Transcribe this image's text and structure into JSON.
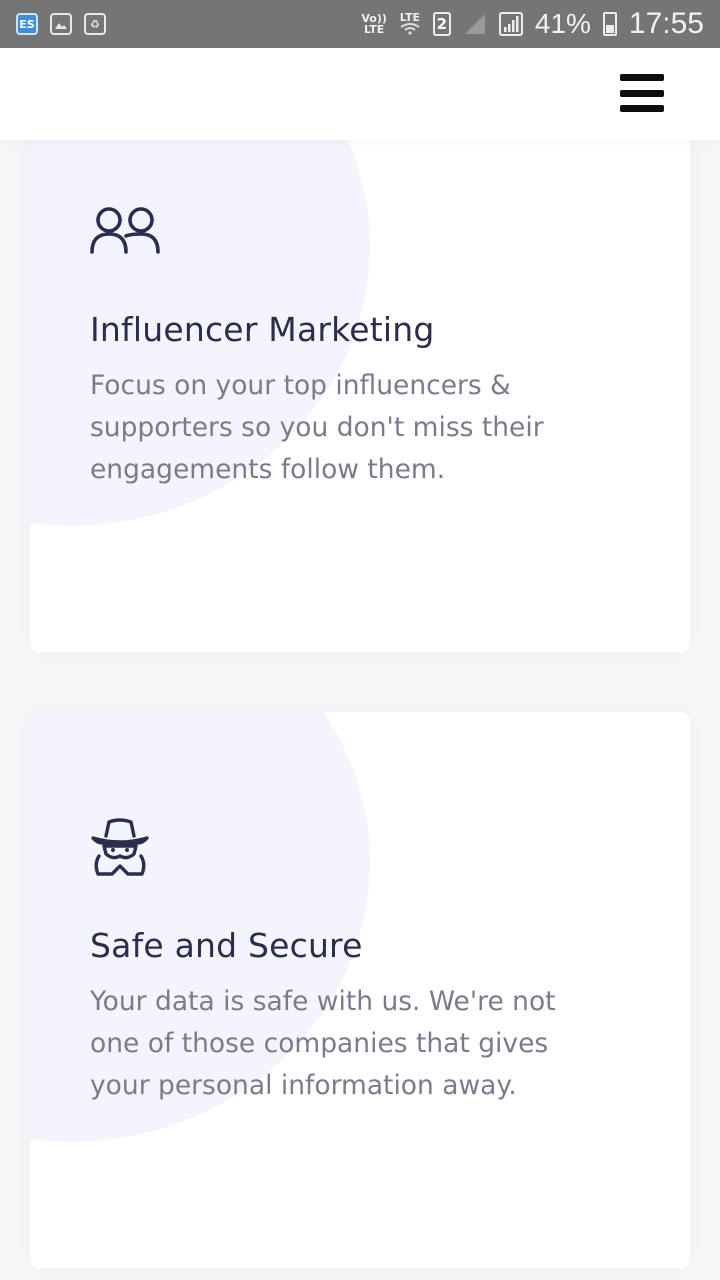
{
  "status_bar": {
    "volte_top": "Vo))",
    "volte_bottom": "LTE",
    "lte_label": "LTE",
    "sim_slot": "2",
    "battery_percent": "41%",
    "time": "17:55",
    "left_icons": [
      "es-file-explorer-icon",
      "gallery-icon",
      "recycle-icon"
    ]
  },
  "navbar": {
    "menu_icon": "hamburger-menu-icon"
  },
  "features": [
    {
      "icon": "users-icon",
      "title": "Influencer Marketing",
      "description": "Focus on your top influencers & supporters so you don't miss their engagements follow them."
    },
    {
      "icon": "spy-incognito-icon",
      "title": "Safe and Secure",
      "description": "Your data is safe with us. We're not one of those companies that gives your personal information away."
    }
  ],
  "colors": {
    "title": "#2c2c4e",
    "description": "#7b7b8e",
    "blob": "#f4f4fd",
    "status_bar": "#757575"
  }
}
